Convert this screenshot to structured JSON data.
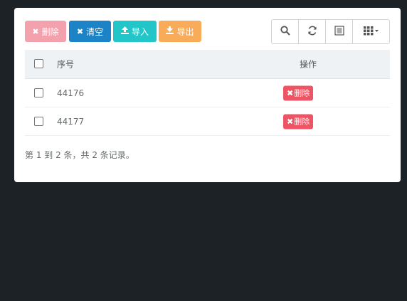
{
  "toolbar": {
    "delete_label": "删除",
    "clear_label": "清空",
    "import_label": "导入",
    "export_label": "导出",
    "tools": [
      "search-icon",
      "refresh-icon",
      "toggle-view-icon",
      "columns-icon"
    ]
  },
  "table": {
    "headers": {
      "id": "序号",
      "actions": "操作"
    },
    "rows": [
      {
        "id": "44176",
        "action_label": "删除"
      },
      {
        "id": "44177",
        "action_label": "删除"
      }
    ]
  },
  "footer": {
    "summary": "第 1 到 2 条，共 2 条记录。"
  },
  "colors": {
    "background": "#1c2226",
    "panel": "#ffffff",
    "delete_disabled": "#f3a2ad",
    "clear": "#1c84c6",
    "import": "#23c6c8",
    "export": "#f8ac59",
    "row_delete": "#ed5565"
  }
}
